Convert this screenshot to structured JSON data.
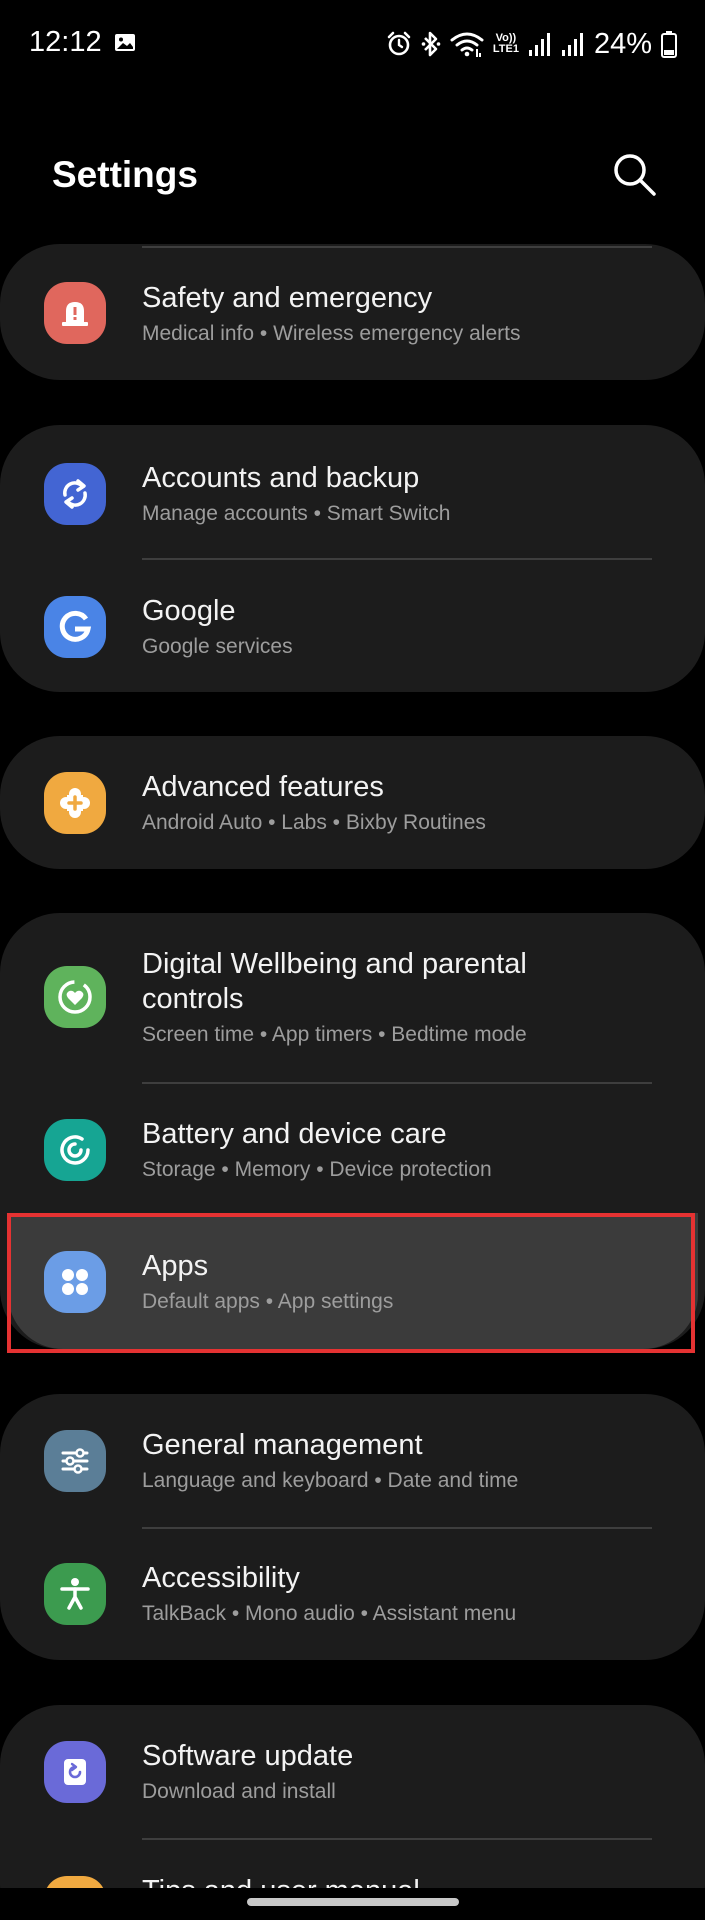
{
  "status_bar": {
    "time": "12:12",
    "network": "LTE1",
    "volte": "Vo))",
    "battery": "24%"
  },
  "header": {
    "title": "Settings",
    "search_icon": "search-icon"
  },
  "items": [
    {
      "title": "Safety and emergency",
      "subtitle": "Medical info  •  Wireless emergency alerts",
      "icon": "siren-icon",
      "color": "#e0675d"
    },
    {
      "title": "Accounts and backup",
      "subtitle": "Manage accounts  •  Smart Switch",
      "icon": "sync-icon",
      "color": "#4365d3"
    },
    {
      "title": "Google",
      "subtitle": "Google services",
      "icon": "google-icon",
      "color": "#4a84e6"
    },
    {
      "title": "Advanced features",
      "subtitle": "Android Auto  •  Labs  •  Bixby Routines",
      "icon": "puzzle-plus-icon",
      "color": "#f0a940"
    },
    {
      "title": "Digital Wellbeing and parental",
      "title2": "controls",
      "subtitle": "Screen time  •  App timers  •  Bedtime mode",
      "icon": "wellbeing-heart-icon",
      "color": "#5fb35c"
    },
    {
      "title": "Battery and device care",
      "subtitle": "Storage  •  Memory  •  Device protection",
      "icon": "device-care-icon",
      "color": "#16a593"
    },
    {
      "title": "Apps",
      "subtitle": "Default apps  •  App settings",
      "icon": "apps-grid-icon",
      "color": "#6b9de6"
    },
    {
      "title": "General management",
      "subtitle": "Language and keyboard  •  Date and time",
      "icon": "sliders-icon",
      "color": "#5b7e97"
    },
    {
      "title": "Accessibility",
      "subtitle": "TalkBack  •  Mono audio  •  Assistant menu",
      "icon": "accessibility-icon",
      "color": "#3c9b4f"
    },
    {
      "title": "Software update",
      "subtitle": "Download and install",
      "icon": "software-update-icon",
      "color": "#6a6ad8"
    },
    {
      "title": "Tips and user manual",
      "icon": "tips-icon",
      "color": "#f0a940"
    }
  ]
}
